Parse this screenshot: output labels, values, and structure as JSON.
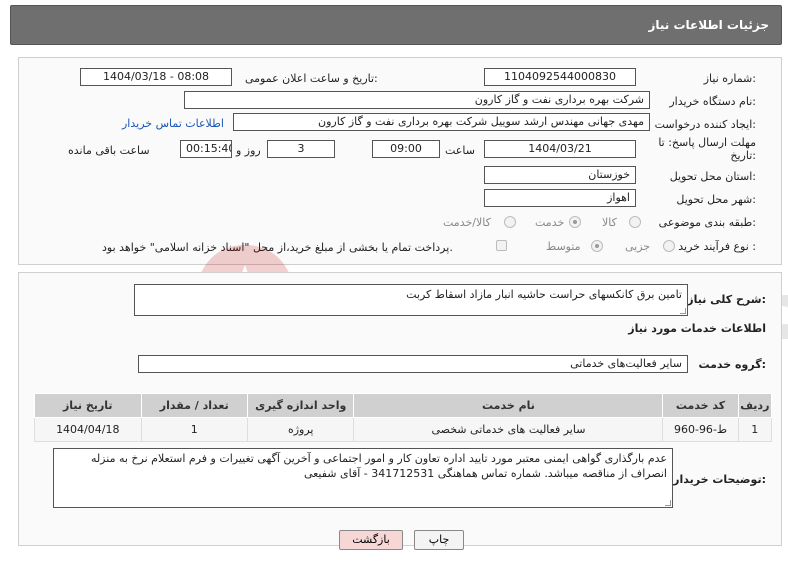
{
  "header": {
    "title": "جزئیات اطلاعات نیاز"
  },
  "form": {
    "need_number_label": "شماره نیاز:",
    "need_number": "1104092544000830",
    "announce_label": "تاریخ و ساعت اعلان عمومی:",
    "announce_value": "1404/03/18 - 08:08",
    "buyer_org_label": "نام دستگاه خریدار:",
    "buyer_org": "شرکت بهره برداری نفت و گاز کارون",
    "creator_label": "ایجاد کننده درخواست:",
    "creator": "مهدی جهانی مهندس ارشد سوییل شرکت بهره برداری نفت و گاز کارون",
    "contact_link": "اطلاعات تماس خریدار",
    "deadline_label": "مهلت ارسال پاسخ: تا تاریخ:",
    "deadline_date": "1404/03/21",
    "time_label": "ساعت",
    "deadline_time": "09:00",
    "days_value": "3",
    "days_label": "روز و",
    "remaining_time": "00:15:40",
    "remaining_label": "ساعت باقی مانده",
    "province_label": "استان محل تحویل:",
    "province": "خوزستان",
    "city_label": "شهر محل تحویل:",
    "city": "اهواز",
    "category_label": "طبقه بندی موضوعی:",
    "category_options": [
      "کالا",
      "خدمت",
      "کالا/خدمت"
    ],
    "category_selected": "خدمت",
    "process_label": "نوع فرآیند خرید :",
    "process_options": [
      "جزیی",
      "متوسط"
    ],
    "process_selected": "متوسط",
    "payment_note": "پرداخت تمام یا بخشی از مبلغ خرید،از محل \"اسناد خزانه اسلامی\" خواهد بود."
  },
  "summary": {
    "label": "شرح کلی نیاز:",
    "value": "تامین برق کانکسهای حراست حاشیه انبار مازاد اسقاط کربت"
  },
  "services": {
    "section_title": "اطلاعات خدمات مورد نیاز",
    "group_label": "گروه خدمت:",
    "group_value": "سایر فعالیت‌های خدماتی",
    "columns": [
      "ردیف",
      "کد خدمت",
      "نام خدمت",
      "واحد اندازه گیری",
      "تعداد / مقدار",
      "تاریخ نیاز"
    ],
    "rows": [
      [
        "1",
        "ط-96-960",
        "سایر فعالیت های خدماتی شخصی",
        "پروژه",
        "1",
        "1404/04/18"
      ]
    ]
  },
  "notes": {
    "label": "توضیحات خریدار:",
    "value": "عدم بارگذاری گواهی ایمنی معتبر مورد تایید اداره تعاون کار و امور اجتماعی و آخرین آگهی تغییرات و فرم استعلام نرخ به منزله انصراف از مناقصه میباشد. شماره تماس هماهنگی 341712531 - آقای شفیعی"
  },
  "buttons": {
    "print": "چاپ",
    "back": "بازگشت"
  },
  "colors": {
    "header_bg": "#6f6f6f",
    "link": "#1a56b6",
    "back_btn_bg": "#f7d6d6"
  }
}
